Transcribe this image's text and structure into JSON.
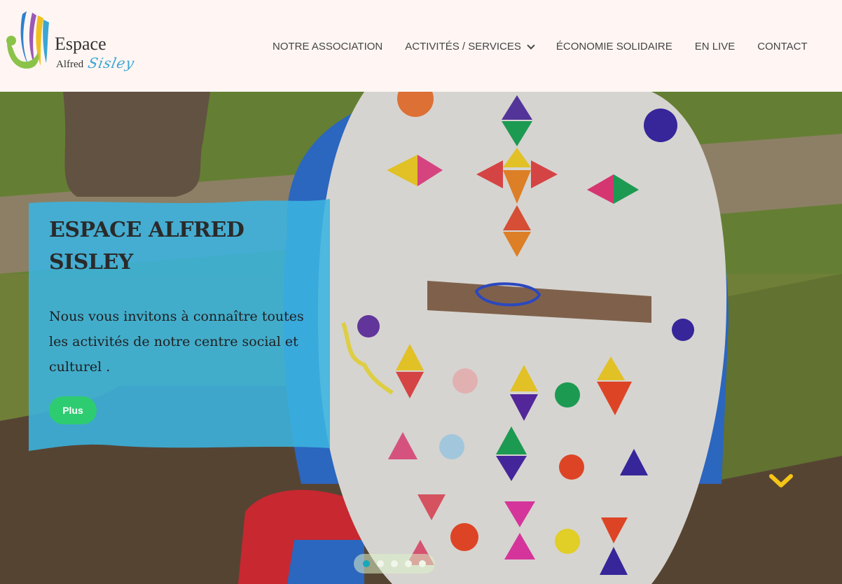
{
  "logo": {
    "word1": "Espace",
    "word2": "Alfred",
    "word3": "Sisley"
  },
  "nav": {
    "items": [
      {
        "label": "NOTRE ASSOCIATION"
      },
      {
        "label": "ACTIVITÉS / SERVICES"
      },
      {
        "label": "ÉCONOMIE SOLIDAIRE"
      },
      {
        "label": "EN LIVE"
      },
      {
        "label": "CONTACT"
      }
    ]
  },
  "hero": {
    "title": "ESPACE ALFRED SISLEY",
    "text": "Nous vous invitons à connaître toutes les activités de notre centre social et culturel .",
    "button_label": "Plus",
    "slide_count": 5,
    "active_slide": 1
  },
  "colors": {
    "header_bg": "#fff6f3",
    "panel": "#3bb4e0",
    "button": "#2ecc71",
    "scroll_arrow": "#f5c518",
    "active_dot": "#17a7b8"
  },
  "icons": {
    "dropdown": "chevron-down-icon",
    "scroll": "chevron-down-icon"
  }
}
